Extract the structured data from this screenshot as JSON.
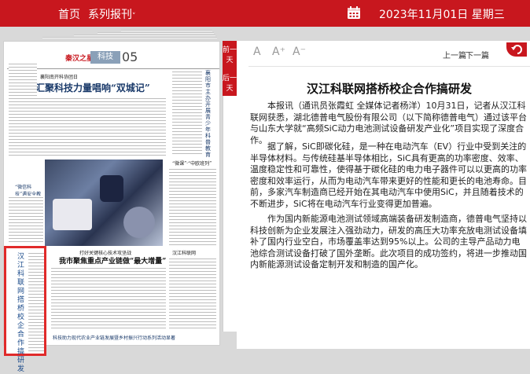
{
  "topbar": {
    "home": "首页",
    "series": "系列报刊",
    "series_caret": "˅",
    "date": "2023年11月01日 星期三",
    "calendar_icon": "calendar-icon"
  },
  "newspaper": {
    "brand": "秦汉之星",
    "section": "科技",
    "page_number": "05",
    "headline_small": "襄阳南开科协团日",
    "headline_main": "汇聚科技力量唱响“双城记”",
    "side_text": "襄阳市主办开展青少年科普教育",
    "photo_caption": "“微信科技”遇安全教育",
    "sub_headline_kicker": "打好关键核心技术攻坚战",
    "sub_headline": "我市聚焦重点产业链做“最大增量”",
    "col_kicker": "汉江科联网",
    "boxed_title": "汉江科联网搭桥校企合作搞研发",
    "bottom_title": "科技助力现代农业产业链发展暨乡村振兴行动系列活动显著"
  },
  "ribbon": {
    "prev_day": "前一天",
    "next_day": "后一天"
  },
  "reader": {
    "font_default": "A",
    "font_plus": "A⁺",
    "font_minus": "A⁻",
    "prev_article": "上一篇",
    "next_article": "下一篇",
    "title": "汉江科联网搭桥校企合作搞研发",
    "paragraphs": [
      "本报讯（通讯员张霞虹 全媒体记者杨洋）10月31日，记者从汉江科联网获悉，湖北德普电气股份有限公司（以下简称德普电气）通过该平台与山东大学就“高频SiC动力电池测试设备研发产业化”项目实现了深度合作。",
      "据了解，SiC即碳化硅，是一种在电动汽车（EV）行业中受到关注的半导体材料。与传统硅基半导体相比，SiC具有更高的功率密度、效率、温度稳定性和可靠性，使得基于碳化硅的电力电子器件可以以更高的功率密度和效率运行，从而为电动汽车带来更好的性能和更长的电池寿命。目前，多家汽车制造商已经开始在其电动汽车中使用SiC，并且随着技术的不断进步，SiC将在电动汽车行业变得更加普遍。",
      "作为国内新能源电池测试领域高端装备研发制造商，德普电气坚持以科技创新为企业发展注入强劲动力，研发的高压大功率充放电测试设备填补了国内行业空白，市场覆盖率达到95%以上。公司的主导产品动力电池综合测试设备打破了国外垄断。此次项目的成功签约，将进一步推动国内新能源测试设备定制开发和制造的国产化。"
    ]
  }
}
